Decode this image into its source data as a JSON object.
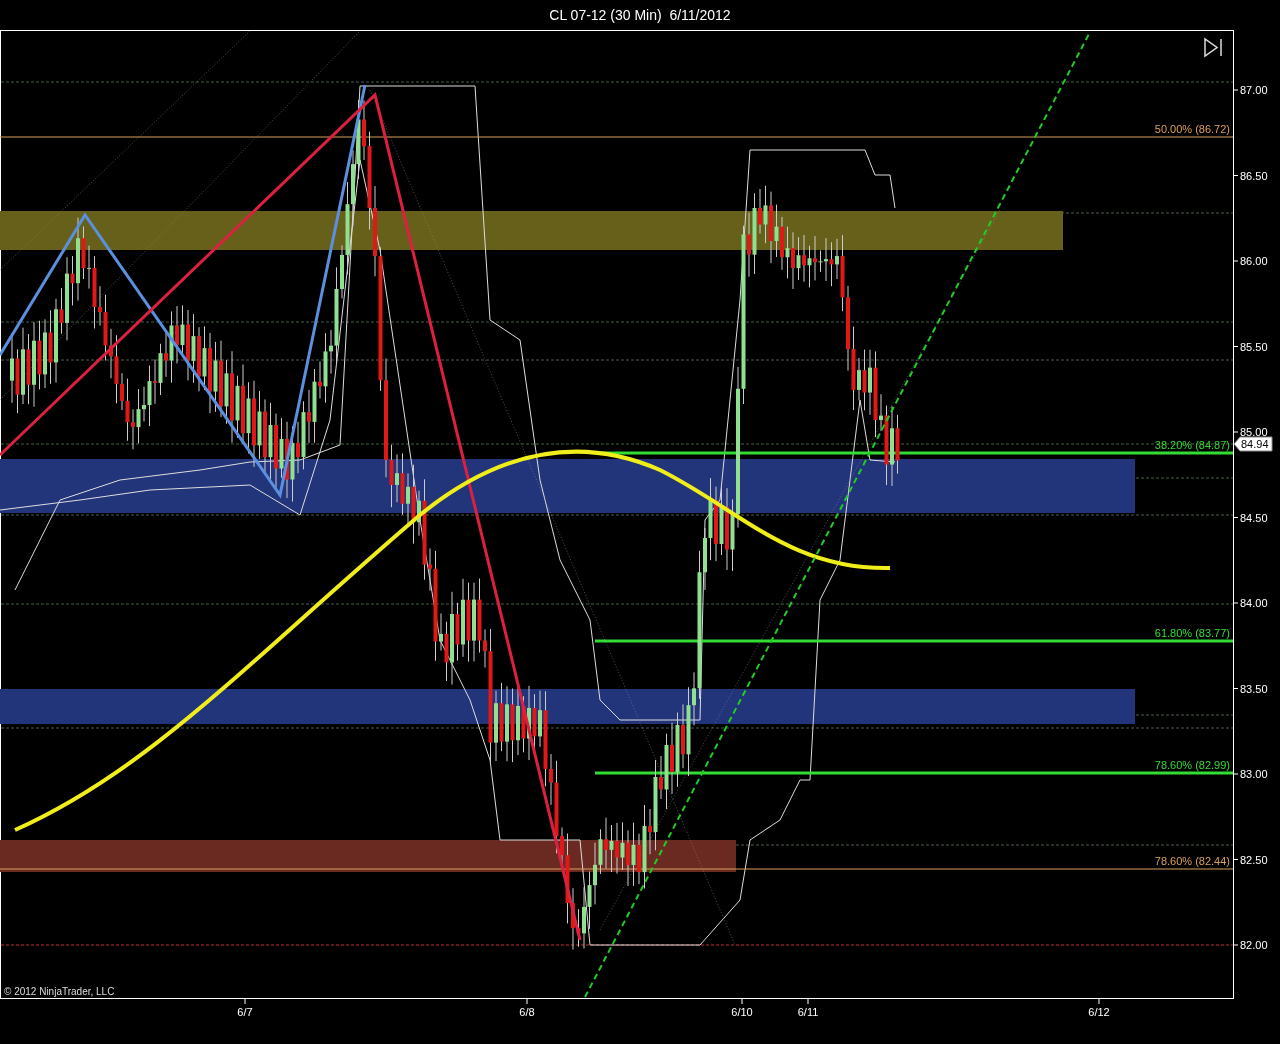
{
  "window": {
    "title": "CL 07-12 (30 Min)  6/11/2012"
  },
  "chart": {
    "price_axis": [
      "87.00",
      "86.50",
      "86.00",
      "85.50",
      "85.00",
      "84.50",
      "84.00",
      "83.50",
      "83.00",
      "82.50",
      "82.00"
    ],
    "time_axis": [
      "6/7",
      "6/8",
      "6/10",
      "6/11",
      "6/12"
    ],
    "fib_levels": [
      {
        "label": "50.00% (86.72)",
        "color": "#d9a05b"
      },
      {
        "label": "38.20% (84.87)",
        "color": "#33dd33"
      },
      {
        "label": "61.80% (83.77)",
        "color": "#33dd33"
      },
      {
        "label": "78.60% (82.99)",
        "color": "#33dd33"
      },
      {
        "label": "78.60% (82.44)",
        "color": "#d9a05b"
      }
    ],
    "last_price": "84.94",
    "copyright": "© 2012 NinjaTrader, LLC"
  }
}
